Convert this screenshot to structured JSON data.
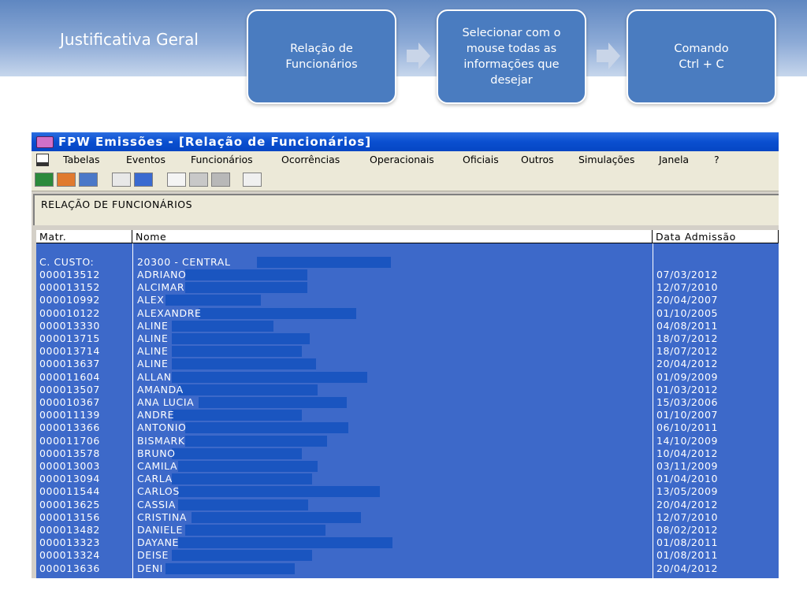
{
  "slide": {
    "title": "Justificativa Geral",
    "steps": [
      "Relação de\nFuncionários",
      "Selecionar com o\nmouse todas as\ninformações que\ndesejar",
      "Comando\nCtrl + C"
    ]
  },
  "window": {
    "title": "FPW  Emissões - [Relação de Funcionários]",
    "menu": [
      "Tabelas",
      "Eventos",
      "Funcionários",
      "Ocorrências",
      "Operacionais",
      "Oficiais",
      "Outros",
      "Simulações",
      "Janela",
      "?"
    ],
    "report_title": "RELAÇÃO DE FUNCIONÁRIOS",
    "columns": [
      "Matr.",
      "Nome",
      "Data Admissão"
    ],
    "cost_center": {
      "label": "C. CUSTO:",
      "value": "20300 - CENTRAL"
    },
    "rows": [
      {
        "matr": "000013512",
        "nome": "ADRIANO",
        "data": "07/03/2012"
      },
      {
        "matr": "000013152",
        "nome": "ALCIMAR",
        "data": "12/07/2010"
      },
      {
        "matr": "000010992",
        "nome": "ALEX",
        "data": "20/04/2007"
      },
      {
        "matr": "000010122",
        "nome": "ALEXANDRE",
        "data": "01/10/2005"
      },
      {
        "matr": "000013330",
        "nome": "ALINE",
        "data": "04/08/2011"
      },
      {
        "matr": "000013715",
        "nome": "ALINE",
        "data": "18/07/2012"
      },
      {
        "matr": "000013714",
        "nome": "ALINE",
        "data": "18/07/2012"
      },
      {
        "matr": "000013637",
        "nome": "ALINE",
        "data": "20/04/2012"
      },
      {
        "matr": "000011604",
        "nome": "ALLAN",
        "data": "01/09/2009"
      },
      {
        "matr": "000013507",
        "nome": "AMANDA",
        "data": "01/03/2012"
      },
      {
        "matr": "000010367",
        "nome": "ANA LUCIA",
        "data": "15/03/2006"
      },
      {
        "matr": "000011139",
        "nome": "ANDRE",
        "data": "01/10/2007"
      },
      {
        "matr": "000013366",
        "nome": "ANTONIO",
        "data": "06/10/2011"
      },
      {
        "matr": "000011706",
        "nome": "BISMARK",
        "data": "14/10/2009"
      },
      {
        "matr": "000013578",
        "nome": "BRUNO",
        "data": "10/04/2012"
      },
      {
        "matr": "000013003",
        "nome": "CAMILA",
        "data": "03/11/2009"
      },
      {
        "matr": "000013094",
        "nome": "CARLA",
        "data": "01/04/2010"
      },
      {
        "matr": "000011544",
        "nome": "CARLOS",
        "data": "13/05/2009"
      },
      {
        "matr": "000013625",
        "nome": "CASSIA",
        "data": "20/04/2012"
      },
      {
        "matr": "000013156",
        "nome": "CRISTINA",
        "data": "12/07/2010"
      },
      {
        "matr": "000013482",
        "nome": "DANIELE",
        "data": "08/02/2012"
      },
      {
        "matr": "000013323",
        "nome": "DAYANE",
        "data": "01/08/2011"
      },
      {
        "matr": "000013324",
        "nome": "DEISE",
        "data": "01/08/2011"
      },
      {
        "matr": "000013636",
        "nome": "DENI",
        "data": "20/04/2012"
      }
    ]
  }
}
